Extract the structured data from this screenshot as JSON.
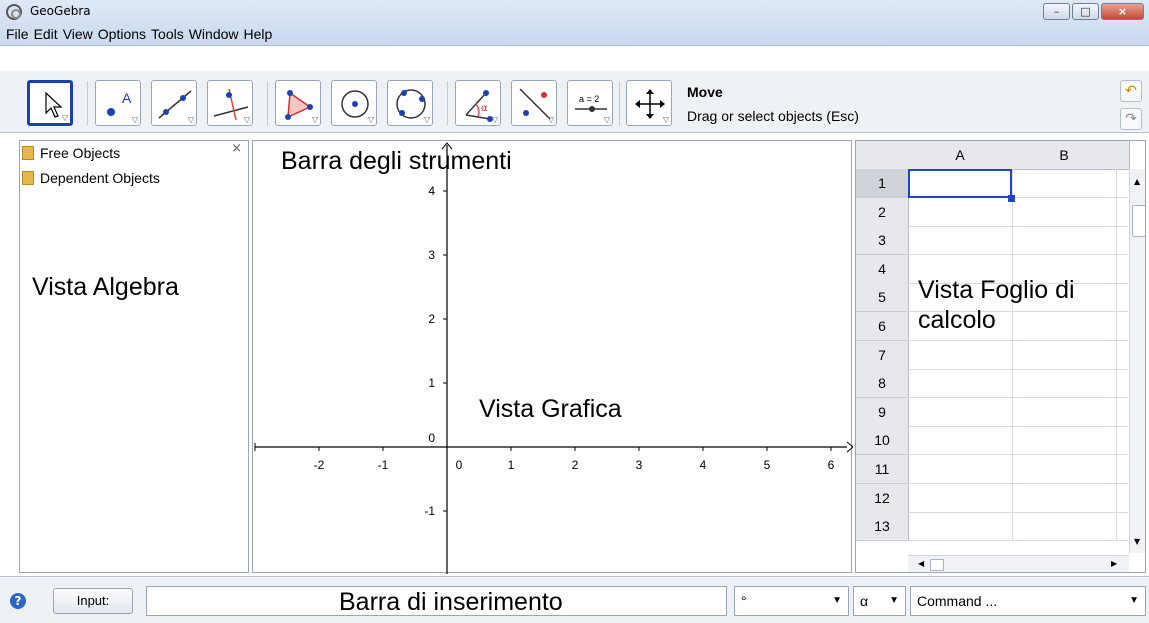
{
  "window": {
    "title": "GeoGebra",
    "min_label": "–",
    "max_label": "□",
    "close_label": "×"
  },
  "menubar": [
    "File",
    "Edit",
    "View",
    "Options",
    "Tools",
    "Window",
    "Help"
  ],
  "toolbar": {
    "tool_name": "Move",
    "tool_help": "Drag or select objects (Esc)",
    "tools": [
      "move-tool",
      "new-point-tool",
      "line-tool",
      "perpendicular-line-tool",
      "polygon-tool",
      "circle-tool",
      "conic-tool",
      "angle-tool",
      "reflect-tool",
      "slider-tool",
      "move-graphics-view-tool"
    ],
    "slider_text": "a = 2",
    "angle_text": "α"
  },
  "algebra": {
    "items": [
      "Free Objects",
      "Dependent Objects"
    ],
    "close": "×",
    "annotation": "Vista Algebra"
  },
  "graphics": {
    "annotation_toolbar": "Barra degli strumenti",
    "annotation_view": "Vista Grafica",
    "x_ticks": [
      "-2",
      "-1",
      "0",
      "1",
      "2",
      "3",
      "4",
      "5",
      "6"
    ],
    "y_ticks": [
      "4",
      "3",
      "2",
      "1",
      "0",
      "-1"
    ]
  },
  "spreadsheet": {
    "columns": [
      "A",
      "B"
    ],
    "rows": [
      "1",
      "2",
      "3",
      "4",
      "5",
      "6",
      "7",
      "8",
      "9",
      "10",
      "11",
      "12",
      "13"
    ],
    "annotation_line1": "Vista Foglio di",
    "annotation_line2": "calcolo"
  },
  "inputbar": {
    "help": "?",
    "input_button": "Input:",
    "annotation": "Barra di inserimento",
    "degree": "°",
    "greek": "α",
    "command": "Command ..."
  },
  "colors": {
    "selection": "#2244cc",
    "toolbar_bg": "#eef1f5",
    "title_bg": "#dfe9f5"
  }
}
